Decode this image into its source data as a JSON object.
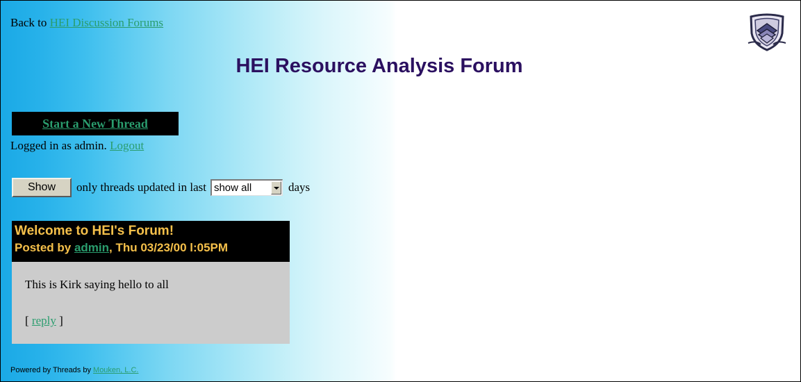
{
  "nav": {
    "back_prefix": "Back to ",
    "back_link": "HEI Discussion Forums",
    "logo_icon": "shield-books-icon"
  },
  "forum": {
    "title": "HEI Resource Analysis Forum"
  },
  "actions": {
    "new_thread": "Start a New Thread"
  },
  "session": {
    "logged_in_text": "Logged in as admin.",
    "logout": "Logout"
  },
  "filter": {
    "show_button": "Show",
    "text": "only threads updated in last",
    "selected": "show all",
    "suffix": "days"
  },
  "post": {
    "title": "Welcome to HEI's Forum!",
    "posted_by": "Posted by ",
    "author": "admin",
    "date": ", Thu 03/23/00 l:05PM",
    "message": "This is Kirk saying hello to all",
    "reply_open": "[ ",
    "reply_link": "reply",
    "reply_close": " ]"
  },
  "footer": {
    "powered_prefix": "Powered by Threads by ",
    "powered_link": "Mouken, L.C."
  },
  "colors": {
    "link": "#2a9d6e",
    "title": "#2b1060",
    "post_header_text": "#f5c04a",
    "post_body_bg": "#cccccc"
  }
}
